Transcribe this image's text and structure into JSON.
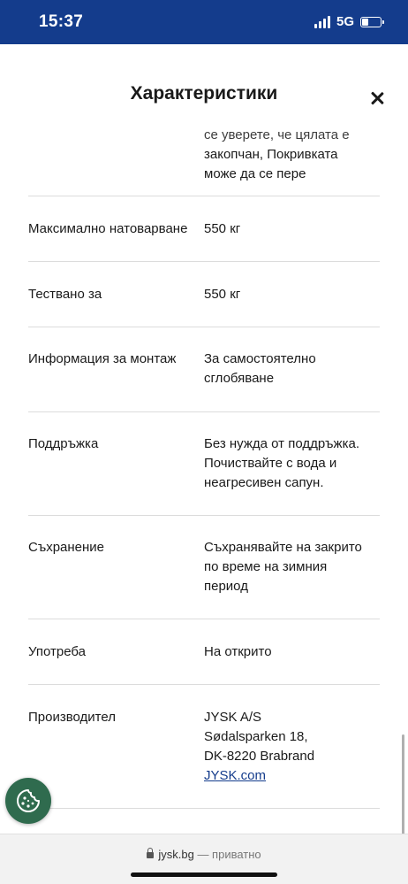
{
  "status_bar": {
    "time": "15:37",
    "network": "5G"
  },
  "sheet": {
    "title": "Характеристики"
  },
  "rows": [
    {
      "label": "",
      "value_lines": [
        "се уверете, че цялата е",
        "закопчан, Покривката",
        "може да се пере"
      ]
    },
    {
      "label": "Максимално натоварване",
      "value_lines": [
        "550 кг"
      ]
    },
    {
      "label": "Тествано за",
      "value_lines": [
        "550 кг"
      ]
    },
    {
      "label": "Информация за монтаж",
      "value_lines": [
        "За самостоятелно",
        "сглобяване"
      ]
    },
    {
      "label": "Поддръжка",
      "value_lines": [
        "Без нужда от поддръжка.",
        "Почиствайте с вода и",
        "неагресивен сапун."
      ]
    },
    {
      "label": "Съхранение",
      "value_lines": [
        "Съхранявайте на закрито",
        "по време на зимния",
        "период"
      ]
    },
    {
      "label": "Употреба",
      "value_lines": [
        "На открито"
      ]
    },
    {
      "label": "Производител",
      "value_lines": [
        "JYSK A/S",
        "Sødalsparken 18,",
        "DK-8220 Brabrand"
      ],
      "link": "JYSK.com"
    }
  ],
  "browser": {
    "domain": "jysk.bg",
    "suffix": "— приватно"
  },
  "colors": {
    "brand": "#143C8C",
    "cookie_button": "#2F6B4E",
    "divider": "#dcdcdc"
  },
  "icons": {
    "close": "close-icon",
    "cookie": "cookie-icon",
    "lock": "lock-icon"
  }
}
